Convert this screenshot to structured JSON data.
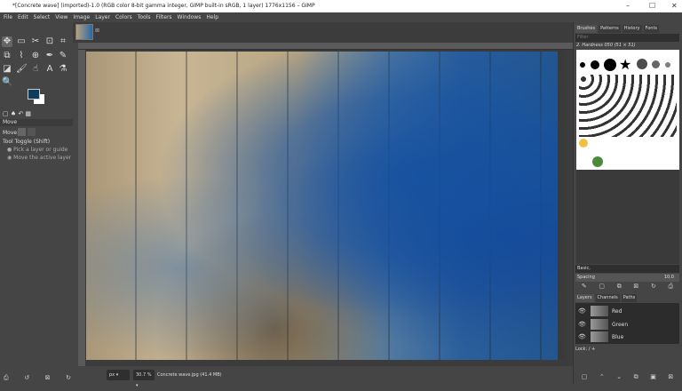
{
  "window": {
    "title": "*[Concrete wave] (imported)-1.0 (RGB color 8-bit gamma integer, GIMP built-in sRGB, 1 layer) 1776x1156 – GIMP",
    "minimize": "–",
    "maximize": "☐",
    "close": "✕"
  },
  "menu": [
    "File",
    "Edit",
    "Select",
    "View",
    "Image",
    "Layer",
    "Colors",
    "Tools",
    "Filters",
    "Windows",
    "Help"
  ],
  "tool_options": {
    "title": "Move",
    "move_label": "Move:",
    "tool_toggle": "Tool Toggle  (Shift)",
    "option1": "Pick a layer or guide",
    "option2": "Move the active layer"
  },
  "colors": {
    "foreground": "#0d3d5c",
    "background": "#ffffff"
  },
  "status": {
    "unit": "px",
    "zoom": "30.7 %",
    "file_info": "Concrete wave.jpg (41.4 MB)"
  },
  "brushes_panel": {
    "tabs": [
      "Brushes",
      "Patterns",
      "History",
      "Fonts"
    ],
    "filter_placeholder": "Filter",
    "brush_name": "2. Hardness 050 (51 × 51)",
    "preset": "Basic,",
    "spacing_label": "Spacing",
    "spacing_value": "10.0"
  },
  "layers_panel": {
    "tabs": [
      "Layers",
      "Channels",
      "Paths"
    ],
    "layers": [
      {
        "name": "Red"
      },
      {
        "name": "Green"
      },
      {
        "name": "Blue"
      }
    ],
    "lock_label": "Lock:"
  }
}
